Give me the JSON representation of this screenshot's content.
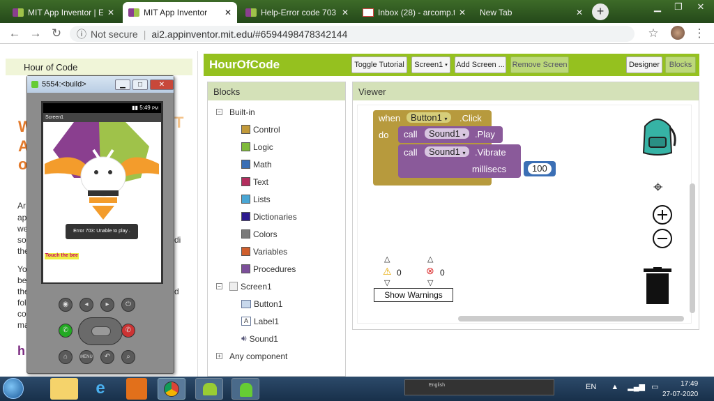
{
  "browser": {
    "tabs": [
      {
        "title": "MIT App Inventor | Ex",
        "favicon": "app-inventor-icon",
        "active": false
      },
      {
        "title": "MIT App Inventor",
        "favicon": "app-inventor-icon",
        "active": true
      },
      {
        "title": "Help-Error code 703",
        "favicon": "app-inventor-icon",
        "active": false
      },
      {
        "title": "Inbox (28) - arcomp.t",
        "favicon": "gmail-icon",
        "active": false
      },
      {
        "title": "New Tab",
        "favicon": "",
        "active": false
      }
    ],
    "new_tab": "+",
    "not_secure": "Not secure",
    "url": "ai2.appinventor.mit.edu/#6594498478342144"
  },
  "left_page": {
    "nav_label": "Hour of Code",
    "heading_fragments": [
      "W",
      "A",
      "o",
      "T"
    ],
    "text_fragments": [
      "Ar",
      "ap",
      "we",
      "so",
      "the",
      "Yo",
      "be",
      "the",
      "fol",
      "co",
      "ma",
      "di",
      "d"
    ],
    "footer_fragment": "h"
  },
  "emulator": {
    "title": "5554:<build>",
    "status_time": "5:49",
    "status_time_suffix": "PM",
    "app_title": "Screen1",
    "toast": "Error 703: Unable to play .",
    "touch_label": "Touch the bee"
  },
  "app": {
    "project_name": "HourOfCode",
    "buttons": {
      "toggle_tutorial": "Toggle Tutorial",
      "screen_select": "Screen1",
      "add_screen": "Add Screen ...",
      "remove_screen": "Remove Screen",
      "designer": "Designer",
      "blocks": "Blocks"
    },
    "blocks_panel": {
      "title": "Blocks",
      "builtin": "Built-in",
      "categories": [
        {
          "label": "Control",
          "color": "#c29a3a"
        },
        {
          "label": "Logic",
          "color": "#7fba3a"
        },
        {
          "label": "Math",
          "color": "#3b6fb5"
        },
        {
          "label": "Text",
          "color": "#b32d5e"
        },
        {
          "label": "Lists",
          "color": "#49a6d4"
        },
        {
          "label": "Dictionaries",
          "color": "#2d1a8f"
        },
        {
          "label": "Colors",
          "color": "#7a7a7a"
        },
        {
          "label": "Variables",
          "color": "#d05f2d"
        },
        {
          "label": "Procedures",
          "color": "#7c4f9a"
        }
      ],
      "screen": "Screen1",
      "components": [
        "Button1",
        "Label1",
        "Sound1"
      ],
      "any_component": "Any component"
    },
    "viewer": {
      "title": "Viewer",
      "event_when": "when",
      "event_component": "Button1",
      "event_name": ".Click",
      "do_label": "do",
      "call1": "call",
      "call1_component": "Sound1",
      "call1_method": ".Play",
      "call2": "call",
      "call2_component": "Sound1",
      "call2_method": ".Vibrate",
      "param": "millisecs",
      "param_value": "100",
      "warnings_count": "0",
      "errors_count": "0",
      "show_warnings": "Show Warnings"
    }
  },
  "taskbar": {
    "lang": "English",
    "locale": "EN",
    "time": "17:49",
    "date": "27-07-2020"
  },
  "colors": {
    "ai_green": "#95c11f",
    "control_block": "#b79a3d",
    "call_block": "#8a5a9a",
    "math_block": "#3b6fb5"
  }
}
